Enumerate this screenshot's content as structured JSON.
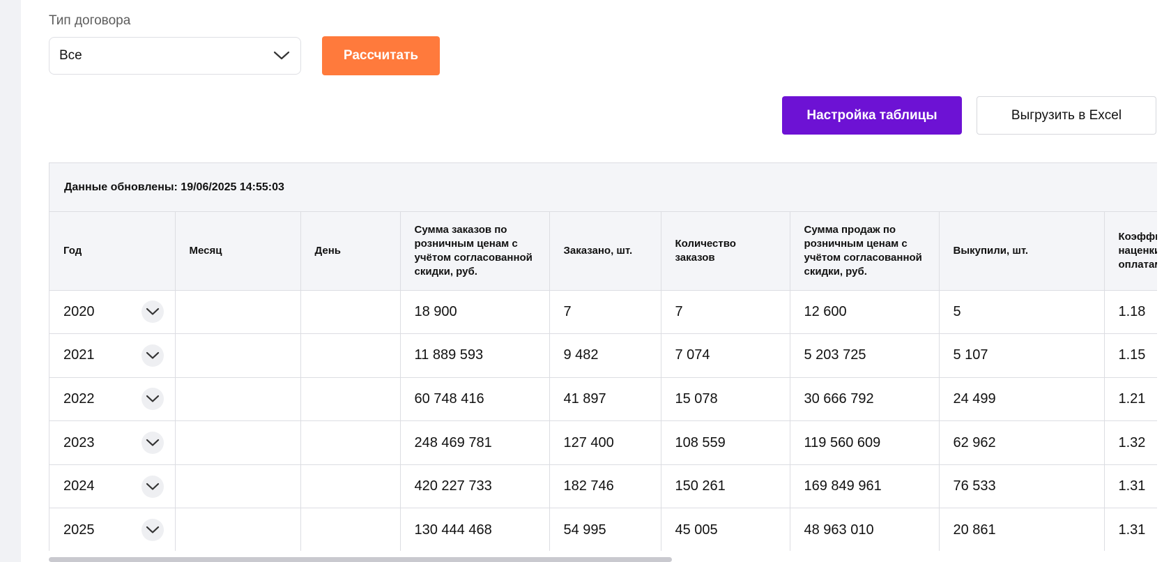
{
  "filter": {
    "label": "Тип договора",
    "selected": "Все"
  },
  "buttons": {
    "calculate": "Рассчитать",
    "table_settings": "Настройка таблицы",
    "export_excel": "Выгрузить в Excel"
  },
  "colors": {
    "calculate_bg": "#ff7a3c",
    "settings_bg": "#6d12d4",
    "header_bg": "#f4f5f8"
  },
  "table": {
    "updated_text": "Данные обновлены: 19/06/2025 14:55:03",
    "headers": [
      "Год",
      "Месяц",
      "День",
      "Сумма заказов по розничным ценам с учётом согласованной скидки, руб.",
      "Заказано, шт.",
      "Количество заказов",
      "Сумма продаж по розничным ценам с учётом согласованной скидки, руб.",
      "Выкупили, шт.",
      "Коэффициент наценки продаж оплатам"
    ],
    "rows": [
      {
        "year": "2020",
        "month": "",
        "day": "",
        "orders_sum": "18 900",
        "ordered_qty": "7",
        "orders_count": "7",
        "sales_sum": "12 600",
        "bought_qty": "5",
        "coef": "1.18"
      },
      {
        "year": "2021",
        "month": "",
        "day": "",
        "orders_sum": "11 889 593",
        "ordered_qty": "9 482",
        "orders_count": "7 074",
        "sales_sum": "5 203 725",
        "bought_qty": "5 107",
        "coef": "1.15"
      },
      {
        "year": "2022",
        "month": "",
        "day": "",
        "orders_sum": "60 748 416",
        "ordered_qty": "41 897",
        "orders_count": "15 078",
        "sales_sum": "30 666 792",
        "bought_qty": "24 499",
        "coef": "1.21"
      },
      {
        "year": "2023",
        "month": "",
        "day": "",
        "orders_sum": "248 469 781",
        "ordered_qty": "127 400",
        "orders_count": "108 559",
        "sales_sum": "119 560 609",
        "bought_qty": "62 962",
        "coef": "1.32"
      },
      {
        "year": "2024",
        "month": "",
        "day": "",
        "orders_sum": "420 227 733",
        "ordered_qty": "182 746",
        "orders_count": "150 261",
        "sales_sum": "169 849 961",
        "bought_qty": "76 533",
        "coef": "1.31"
      },
      {
        "year": "2025",
        "month": "",
        "day": "",
        "orders_sum": "130 444 468",
        "ordered_qty": "54 995",
        "orders_count": "45 005",
        "sales_sum": "48 963 010",
        "bought_qty": "20 861",
        "coef": "1.31"
      }
    ]
  }
}
